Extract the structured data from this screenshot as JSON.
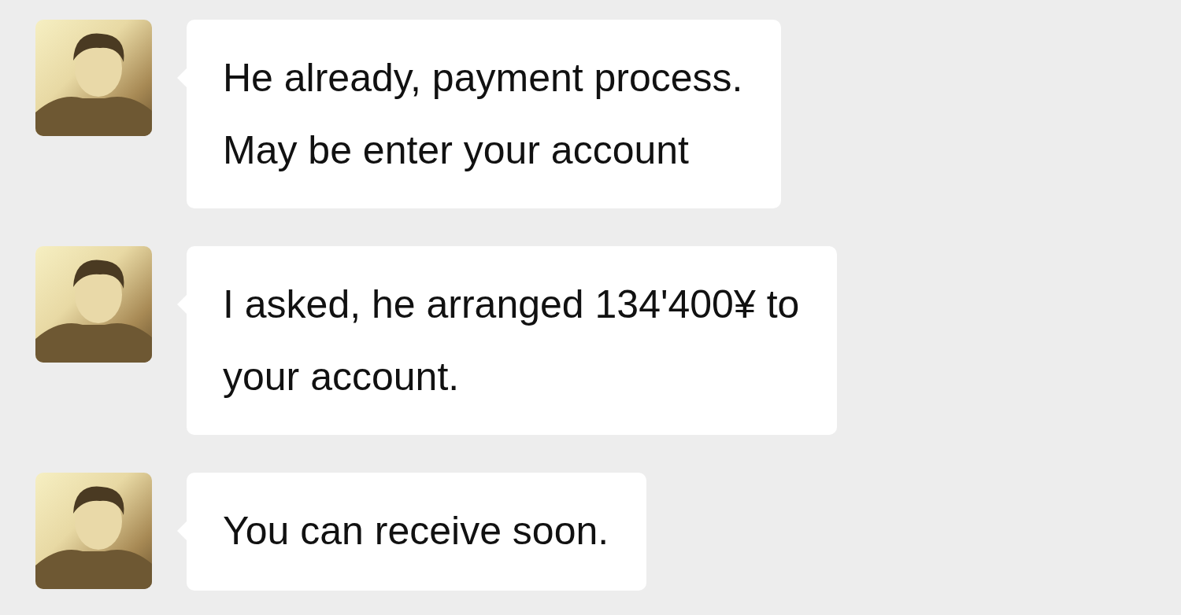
{
  "chat": {
    "messages": [
      {
        "sender": "contact",
        "lines": [
          "He already, payment process.",
          "May be enter your account"
        ]
      },
      {
        "sender": "contact",
        "lines": [
          "I asked, he arranged 134'400¥ to",
          "your account."
        ]
      },
      {
        "sender": "contact",
        "lines": [
          "You can receive soon."
        ]
      }
    ]
  }
}
